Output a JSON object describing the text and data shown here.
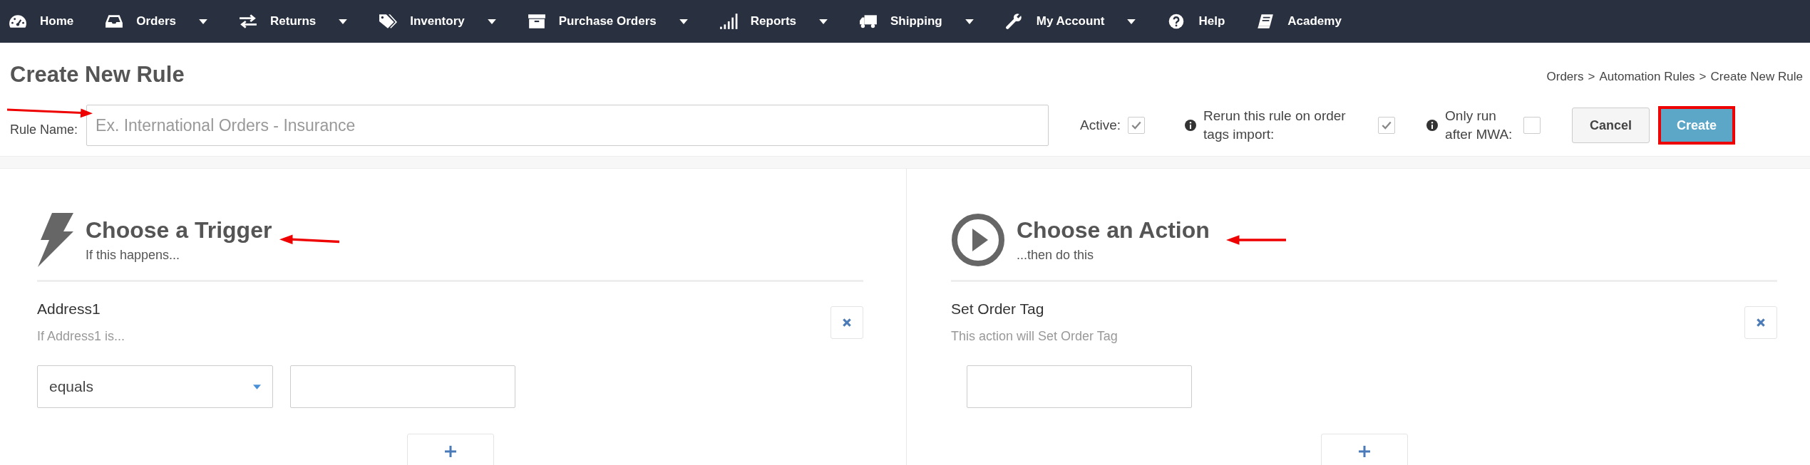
{
  "nav": [
    {
      "label": "Home",
      "dropdown": false
    },
    {
      "label": "Orders",
      "dropdown": true
    },
    {
      "label": "Returns",
      "dropdown": true
    },
    {
      "label": "Inventory",
      "dropdown": true
    },
    {
      "label": "Purchase Orders",
      "dropdown": true
    },
    {
      "label": "Reports",
      "dropdown": true
    },
    {
      "label": "Shipping",
      "dropdown": true
    },
    {
      "label": "My Account",
      "dropdown": true
    },
    {
      "label": "Help",
      "dropdown": false
    },
    {
      "label": "Academy",
      "dropdown": false
    }
  ],
  "page_title": "Create New Rule",
  "breadcrumb": [
    "Orders",
    "Automation Rules",
    "Create New Rule"
  ],
  "breadcrumb_separator": ">",
  "rule_name": {
    "label": "Rule Name:",
    "placeholder": "Ex. International Orders - Insurance"
  },
  "options": [
    {
      "label": "Active:",
      "info": false,
      "checked": true
    },
    {
      "label": "Rerun this rule on order tags import:",
      "info": true,
      "checked": true
    },
    {
      "label": "Only run after MWA:",
      "info": true,
      "checked": false
    }
  ],
  "buttons": [
    {
      "label": "Cancel",
      "kind": "default"
    },
    {
      "label": "Create",
      "kind": "primary"
    }
  ],
  "panels": [
    {
      "kind": "trigger",
      "title": "Choose a Trigger",
      "subtitle": "If this happens...",
      "item": {
        "name": "Address1",
        "description": "If Address1 is...",
        "operator": "equals"
      }
    },
    {
      "kind": "action",
      "title": "Choose an Action",
      "subtitle": "...then do this",
      "item": {
        "name": "Set Order Tag",
        "description": "This action will Set Order Tag"
      }
    }
  ]
}
